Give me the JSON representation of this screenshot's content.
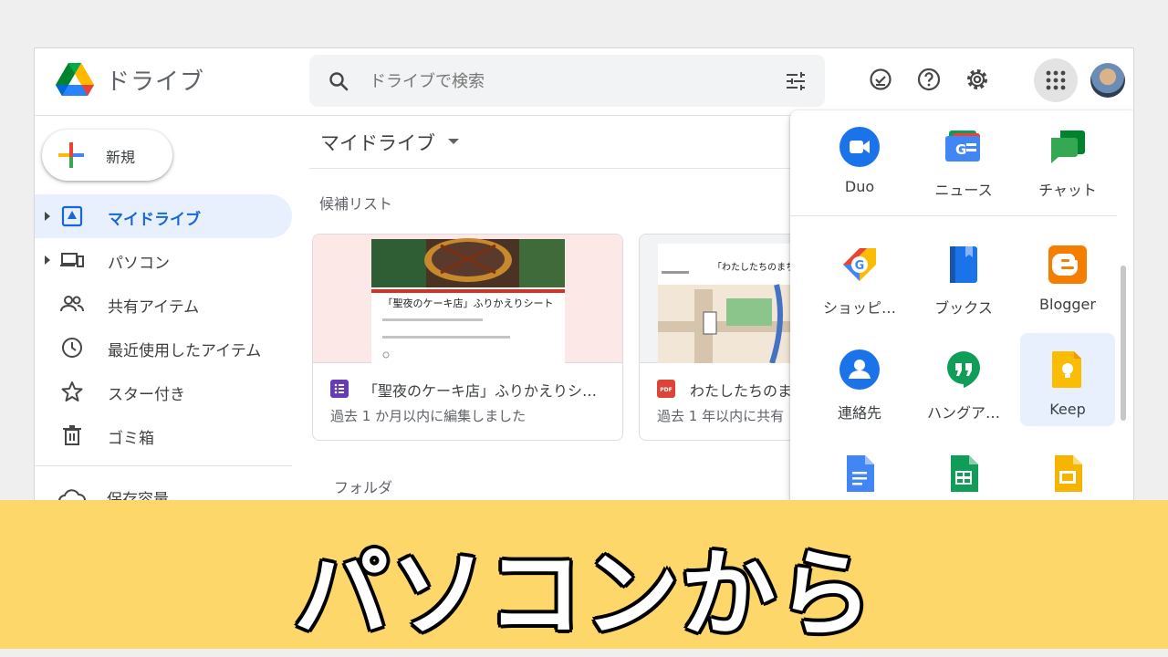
{
  "header": {
    "app_title": "ドライブ",
    "search_placeholder": "ドライブで検索",
    "icons": [
      "drive-logo-icon",
      "search-icon",
      "search-options-icon",
      "ready-offline-icon",
      "help-icon",
      "settings-icon",
      "google-apps-icon",
      "account-avatar"
    ]
  },
  "sidebar": {
    "new_label": "新規",
    "items": [
      {
        "label": "マイドライブ",
        "icon": "my-drive-icon",
        "active": true
      },
      {
        "label": "パソコン",
        "icon": "computers-icon"
      },
      {
        "label": "共有アイテム",
        "icon": "shared-icon"
      },
      {
        "label": "最近使用したアイテム",
        "icon": "clock-icon"
      },
      {
        "label": "スター付き",
        "icon": "star-icon"
      },
      {
        "label": "ゴミ箱",
        "icon": "trash-icon"
      }
    ],
    "storage_label": "保存容量"
  },
  "main": {
    "title": "マイドライブ",
    "suggested_label": "候補リスト",
    "folders_label": "フォルダ",
    "cards": [
      {
        "name": "「聖夜のケーキ店」ふりかえりシ…",
        "meta": "過去 1 か月以内に編集しました",
        "type": "forms",
        "thumb_title": "「聖夜のケーキ店」ふりかえりシート"
      },
      {
        "name": "わたしたちのま",
        "meta": "過去 1 年以内に共有",
        "type": "pdf",
        "thumb_title": "「わたしたちのまち」"
      }
    ]
  },
  "apps_panel": {
    "apps": [
      {
        "label": "Duo",
        "icon": "duo-icon"
      },
      {
        "label": "ニュース",
        "icon": "news-icon"
      },
      {
        "label": "チャット",
        "icon": "chat-icon"
      },
      {
        "label": "ショッピ…",
        "icon": "shopping-icon"
      },
      {
        "label": "ブックス",
        "icon": "books-icon"
      },
      {
        "label": "Blogger",
        "icon": "blogger-icon"
      },
      {
        "label": "連絡先",
        "icon": "contacts-icon"
      },
      {
        "label": "ハングア…",
        "icon": "hangouts-icon"
      },
      {
        "label": "Keep",
        "icon": "keep-icon",
        "selected": true
      },
      {
        "label": "",
        "icon": "docs-icon"
      },
      {
        "label": "",
        "icon": "sheets-icon"
      },
      {
        "label": "",
        "icon": "slides-icon"
      }
    ]
  },
  "banner": {
    "text": "パソコンから",
    "color": "#fdd76a"
  },
  "colors": {
    "accent": "#1967d2",
    "active_bg": "#e8f0fe"
  }
}
